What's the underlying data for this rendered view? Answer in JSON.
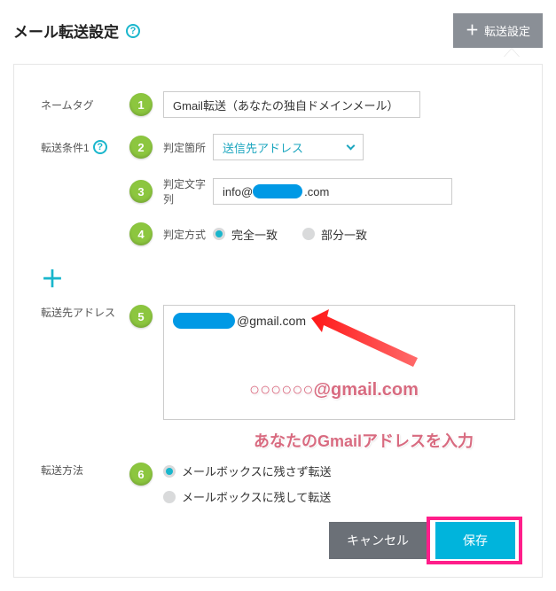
{
  "header": {
    "title": "メール転送設定",
    "help_char": "?",
    "add_button": "転送設定",
    "add_button_plus": "＋"
  },
  "form": {
    "nametag": {
      "label": "ネームタグ",
      "step": "1",
      "value": "Gmail転送（あなたの独自ドメインメール）"
    },
    "condition": {
      "label": "転送条件1",
      "help_char": "?",
      "step_place": "2",
      "place_label": "判定箇所",
      "place_value": "送信先アドレス",
      "step_string": "3",
      "string_label": "判定文字列",
      "string_prefix": "info@",
      "string_suffix": ".com",
      "step_method": "4",
      "method_label": "判定方式",
      "method_options": [
        "完全一致",
        "部分一致"
      ],
      "method_selected": 0
    },
    "add_plus": "＋",
    "forward_to": {
      "label": "転送先アドレス",
      "step": "5",
      "domain_part": "@gmail.com"
    },
    "forward_method": {
      "label": "転送方法",
      "step": "6",
      "options": [
        "メールボックスに残さず転送",
        "メールボックスに残して転送"
      ],
      "selected": 0
    }
  },
  "footer": {
    "cancel": "キャンセル",
    "save": "保存"
  },
  "annotations": {
    "line1": "○○○○○○@gmail.com",
    "line2": "あなたのGmailアドレスを入力"
  }
}
